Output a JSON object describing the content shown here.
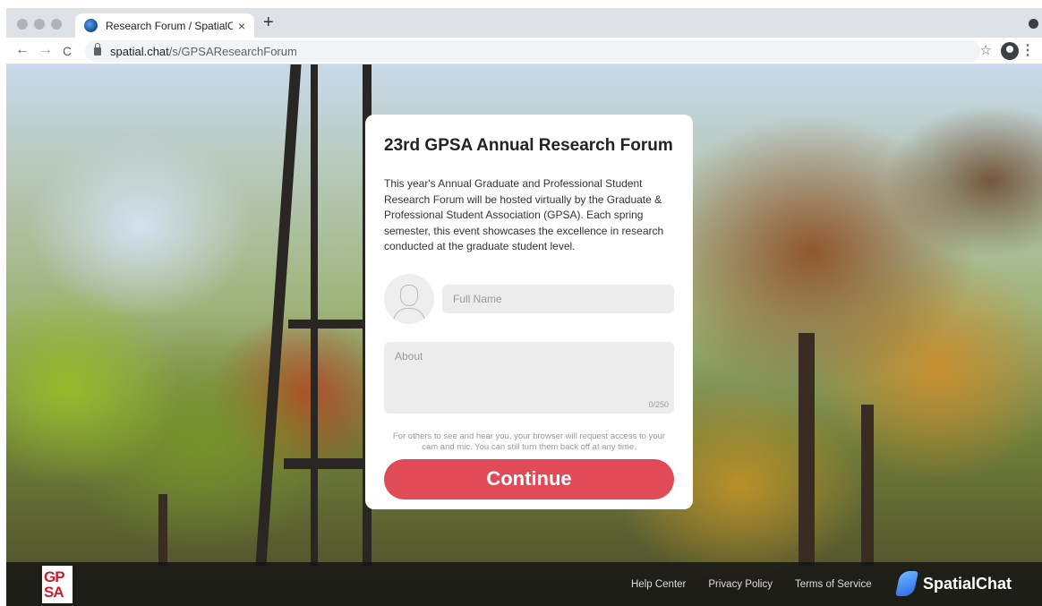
{
  "browser": {
    "tab_title": "Research Forum / SpatialChat",
    "tab_close": "×",
    "new_tab": "+",
    "url_domain": "spatial.chat",
    "url_path": "/s/GPSAResearchForum",
    "back": "←",
    "forward": "→",
    "reload": "C",
    "bookmark": "☆",
    "menu": "⋮"
  },
  "card": {
    "title": "23rd GPSA Annual Research Forum",
    "description": "This year's Annual Graduate and Professional Student Research Forum will be hosted virtually by the Graduate & Professional Student Association (GPSA). Each spring semester, this event showcases the excellence in research conducted at the graduate student level.",
    "name_placeholder": "Full Name",
    "about_placeholder": "About",
    "about_counter": "0/250",
    "notice": "For others to see and hear you, your browser will request access to your cam and mic. You can still turn them back off at any time.",
    "continue_label": "Continue"
  },
  "footer": {
    "logo_top": "GP",
    "logo_bottom": "SA",
    "links": [
      "Help Center",
      "Privacy Policy",
      "Terms of Service"
    ],
    "brand": "SpatialChat"
  },
  "colors": {
    "accent": "#e14a57",
    "footer_bg": "#141414",
    "logo_red": "#c8202e"
  }
}
